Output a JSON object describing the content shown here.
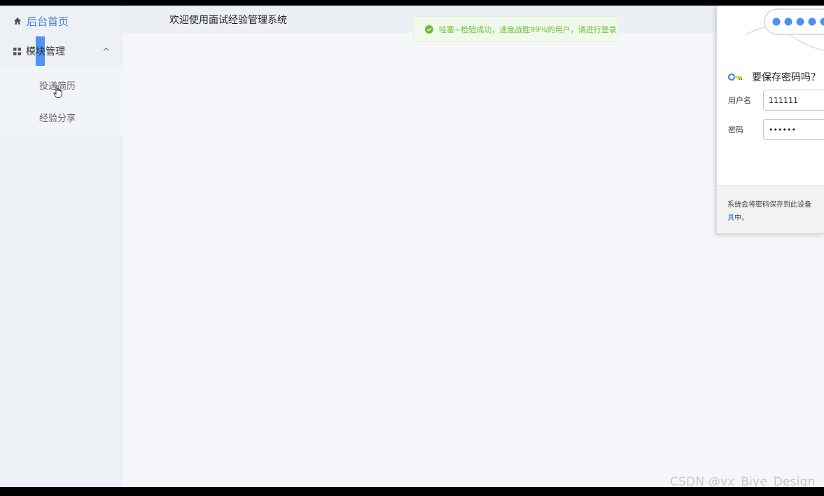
{
  "sidebar": {
    "home_label": "后台首页",
    "module_label": "模块管理",
    "sub_items": [
      {
        "label": "投递简历"
      },
      {
        "label": "经验分享"
      }
    ]
  },
  "header": {
    "title": "欢迎使用面试经验管理系统"
  },
  "toast": {
    "text": "哇塞~检验成功，速度战胜99%的用户，请进行登录",
    "color": "#67c23a"
  },
  "password_prompt": {
    "title": "要保存密码吗？",
    "username_label": "用户名",
    "username_value": "111111",
    "password_label": "密码",
    "password_value": "••••••",
    "footer_text": "系统会将密码保存到此设备",
    "footer_link": "具",
    "footer_tail": "中。"
  },
  "watermark": "CSDN @vx_Biye_Design",
  "colors": {
    "accent": "#3d7bd9",
    "highlight": "#4a8ff0",
    "success": "#67c23a"
  }
}
